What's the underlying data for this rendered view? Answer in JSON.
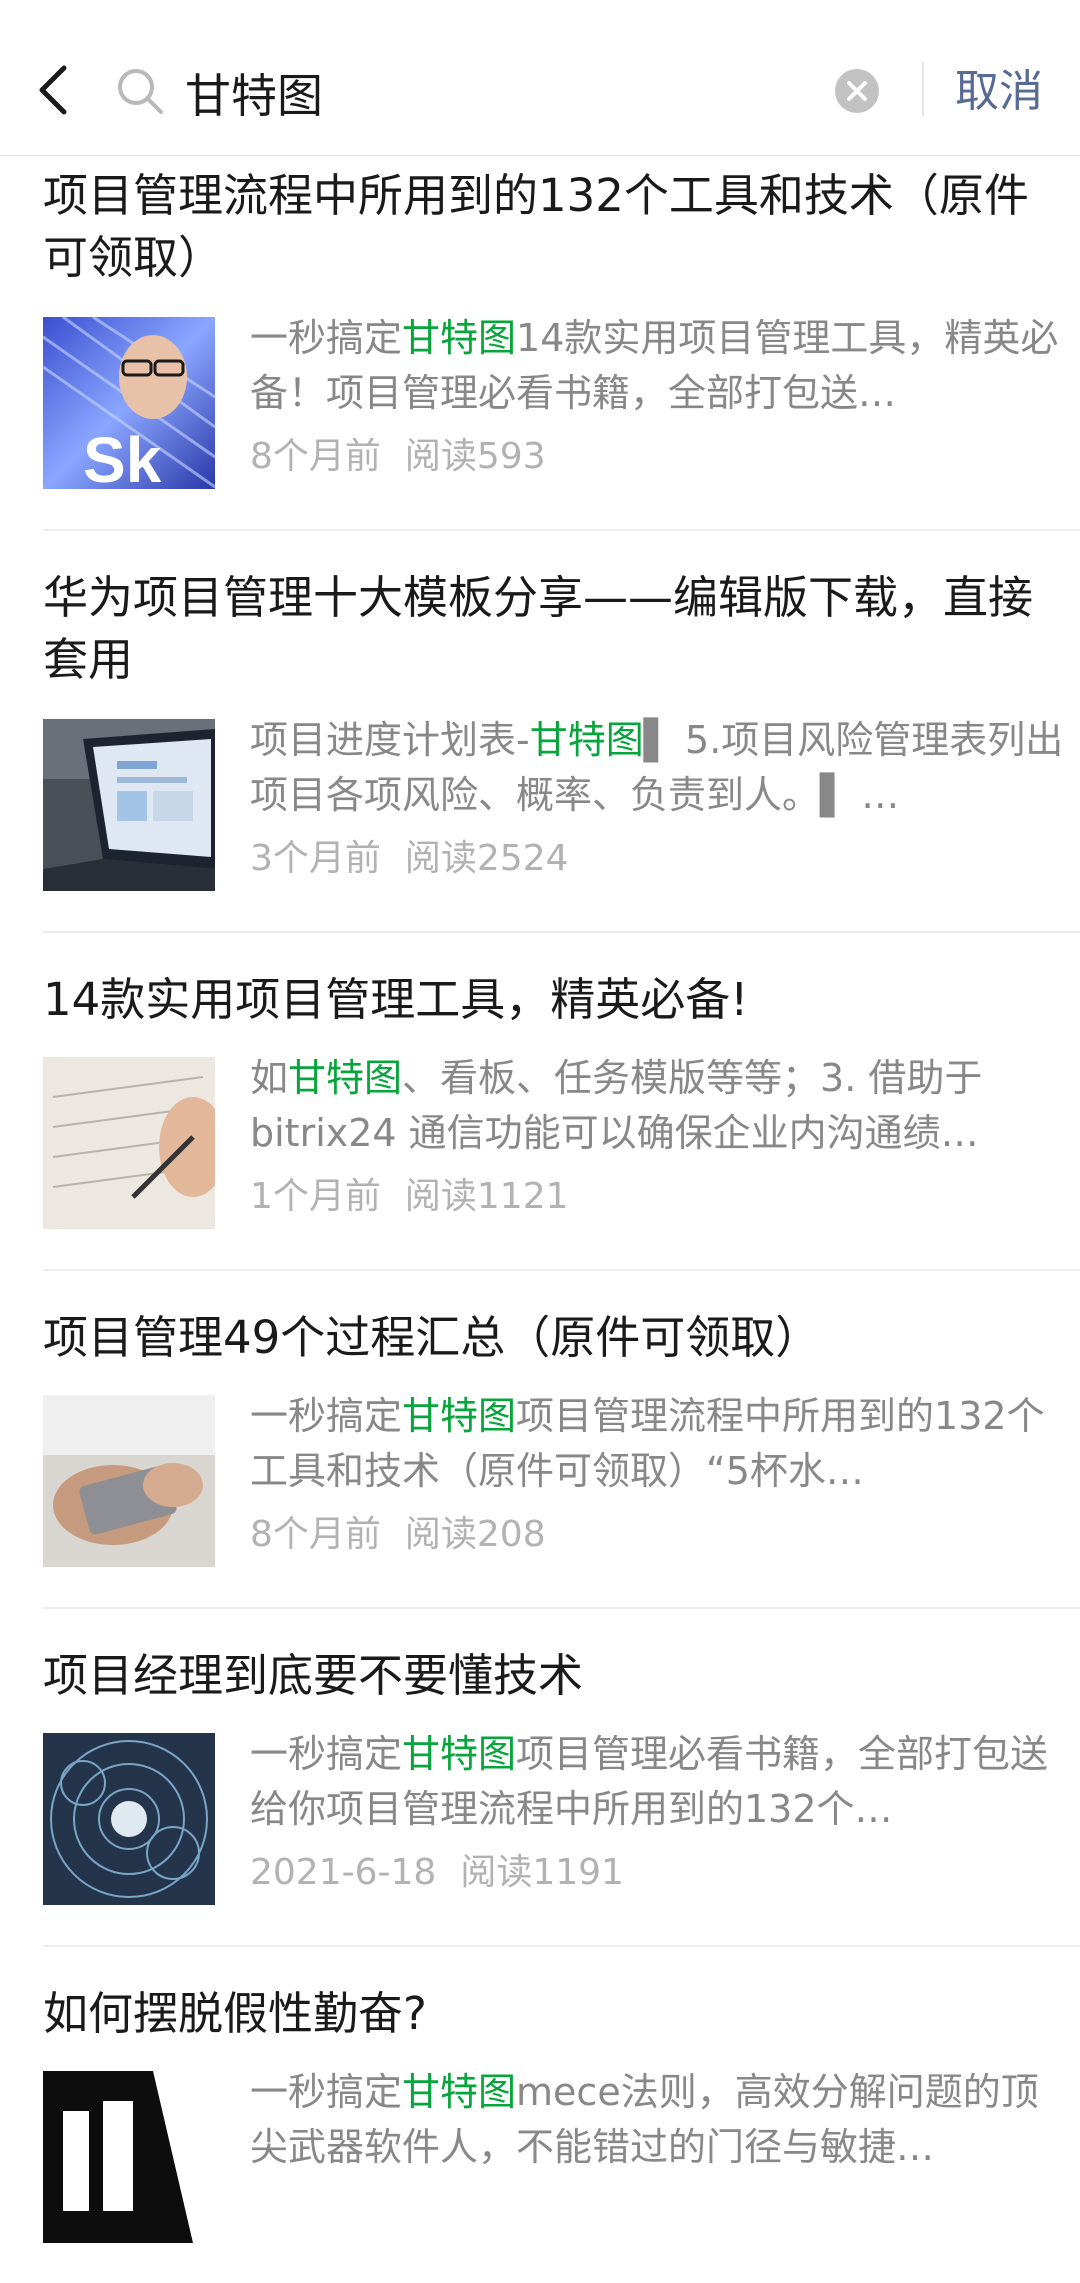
{
  "search": {
    "query": "甘特图",
    "cancel_label": "取消"
  },
  "colors": {
    "highlight": "#07a53b",
    "link": "#576b95"
  },
  "results": [
    {
      "title": "项目管理流程中所用到的132个工具和技术（原件可领取）",
      "snippet_pre": "一秒搞定",
      "snippet_hl": "甘特图",
      "snippet_post": "14款实用项目管理工具，精英必备！项目管理必看书籍，全部打包送…",
      "time": "8个月前",
      "reads": "阅读593",
      "thumb": "thumb-woman-glasses"
    },
    {
      "title": "华为项目管理十大模板分享——编辑版下载，直接套用",
      "snippet_pre": "项目进度计划表-",
      "snippet_hl": "甘特图",
      "snippet_post": "▌ 5.项目风险管理表列出项目各项风险、概率、负责到人。▌ …",
      "time": "3个月前",
      "reads": "阅读2524",
      "thumb": "thumb-laptop"
    },
    {
      "title": "14款实用项目管理工具，精英必备!",
      "snippet_pre": "如",
      "snippet_hl": "甘特图",
      "snippet_post": "、看板、任务模版等等；3. 借助于bitrix24 通信功能可以确保企业内沟通绩…",
      "time": "1个月前",
      "reads": "阅读1121",
      "thumb": "thumb-writing"
    },
    {
      "title": "项目管理49个过程汇总（原件可领取）",
      "snippet_pre": "一秒搞定",
      "snippet_hl": "甘特图",
      "snippet_post": "项目管理流程中所用到的132个工具和技术（原件可领取）“5杯水…",
      "time": "8个月前",
      "reads": "阅读208",
      "thumb": "thumb-phone-hands"
    },
    {
      "title": "项目经理到底要不要懂技术",
      "snippet_pre": "一秒搞定",
      "snippet_hl": "甘特图",
      "snippet_post": "项目管理必看书籍，全部打包送给你项目管理流程中所用到的132个…",
      "time": "2021-6-18",
      "reads": "阅读1191",
      "thumb": "thumb-tech-network"
    },
    {
      "title": "如何摆脱假性勤奋?",
      "snippet_pre": "一秒搞定",
      "snippet_hl": "甘特图",
      "snippet_post": "mece法则，高效分解问题的顶尖武器软件人，不能错过的门径与敏捷…",
      "time": "",
      "reads": "",
      "thumb": "thumb-black-text"
    }
  ]
}
